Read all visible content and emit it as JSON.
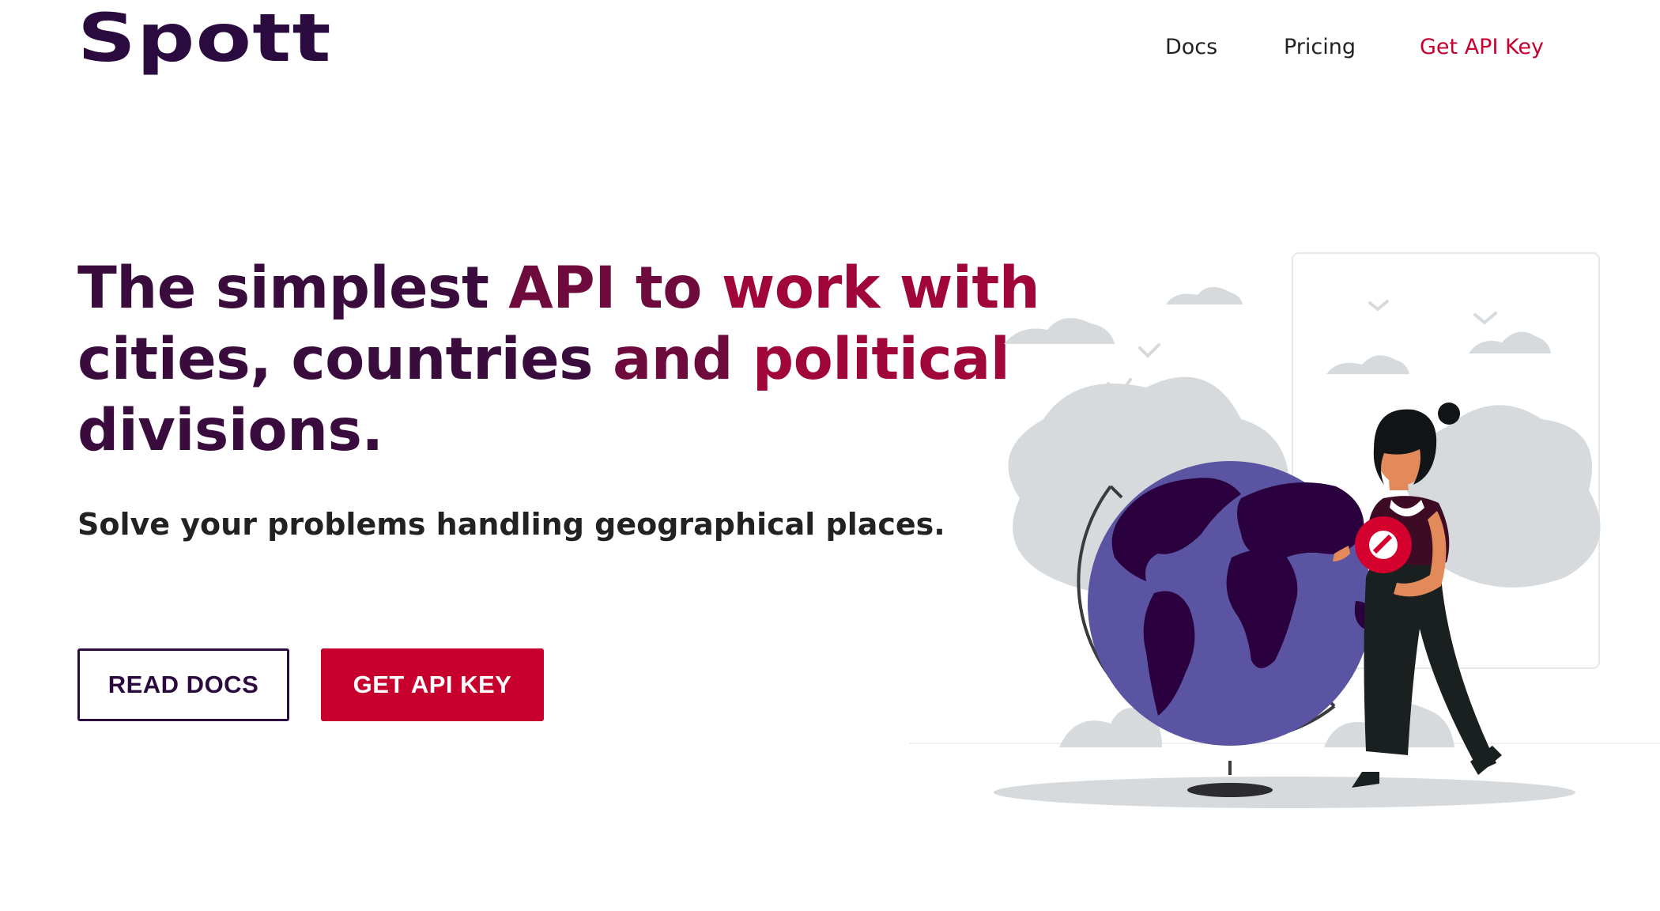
{
  "header": {
    "logo_text": "Spott",
    "nav": [
      {
        "label": "Docs"
      },
      {
        "label": "Pricing"
      },
      {
        "label": "Get API Key"
      }
    ]
  },
  "hero": {
    "headline": {
      "part1": "The simplest ",
      "part2": "API to work with cities, countries and political divisions.",
      "line1a": "The simplest ",
      "line1b": "API to ",
      "line1c": "work with",
      "line2a": "cities, countries ",
      "line2b": "and ",
      "line2c": "political",
      "line3": "divisions."
    },
    "subheadline": "Solve your problems handling geographical places.",
    "buttons": {
      "read_docs": "READ DOCS",
      "get_api_key": "GET API KEY"
    }
  },
  "illustration": {
    "icon": "globe-woman-map-pin-illustration"
  },
  "colors": {
    "brand_dark": "#2b0b3f",
    "accent": "#c8002e",
    "globe_ocean": "#5b54a2",
    "globe_land": "#2b003f",
    "cloud": "#d6dadd"
  }
}
